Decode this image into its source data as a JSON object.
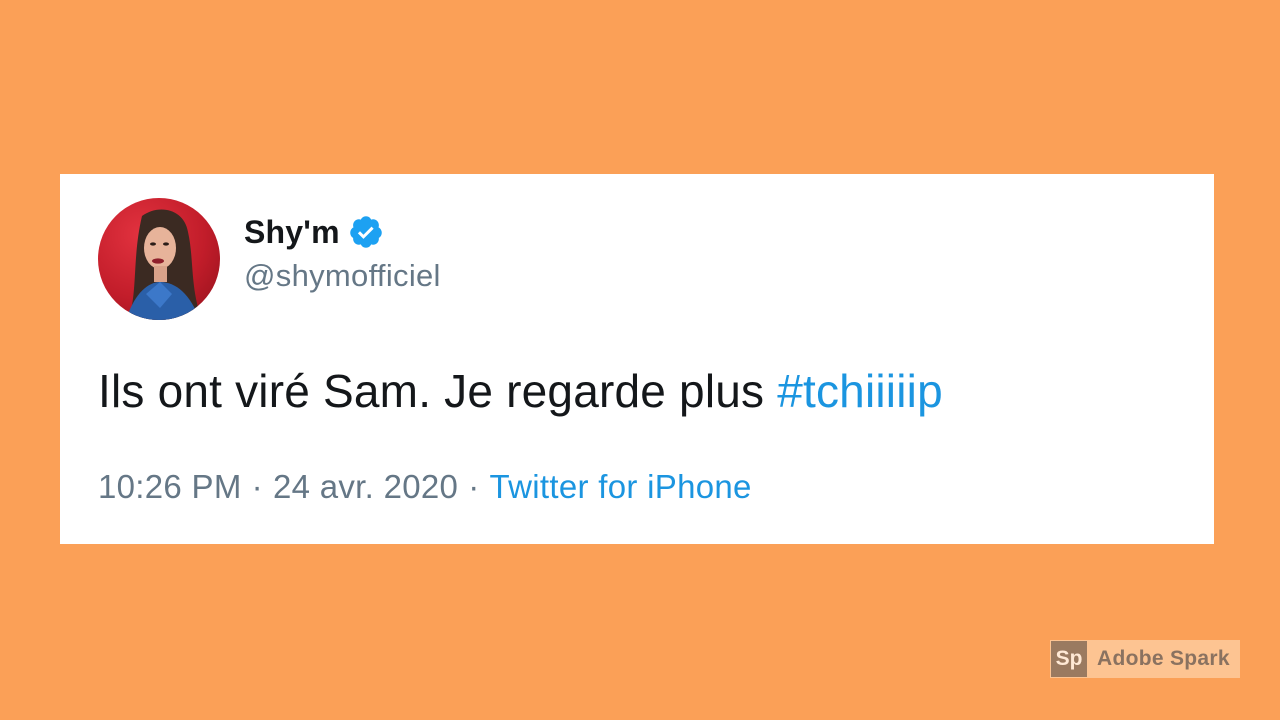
{
  "tweet": {
    "author": {
      "display_name": "Shy'm",
      "handle": "@shymofficiel",
      "verified": true,
      "avatar_icon": "profile-photo"
    },
    "text_main": "Ils ont viré Sam. Je regarde plus ",
    "hashtag": "#tchiiiiip",
    "time": "10:26 PM",
    "separator": "·",
    "date": "24 avr. 2020",
    "source": "Twitter for iPhone"
  },
  "watermark": {
    "logo": "Sp",
    "label": "Adobe Spark"
  },
  "colors": {
    "background": "#FBA057",
    "card": "#FFFFFF",
    "link": "#1B95E0",
    "muted": "#657786",
    "text": "#14171A"
  }
}
